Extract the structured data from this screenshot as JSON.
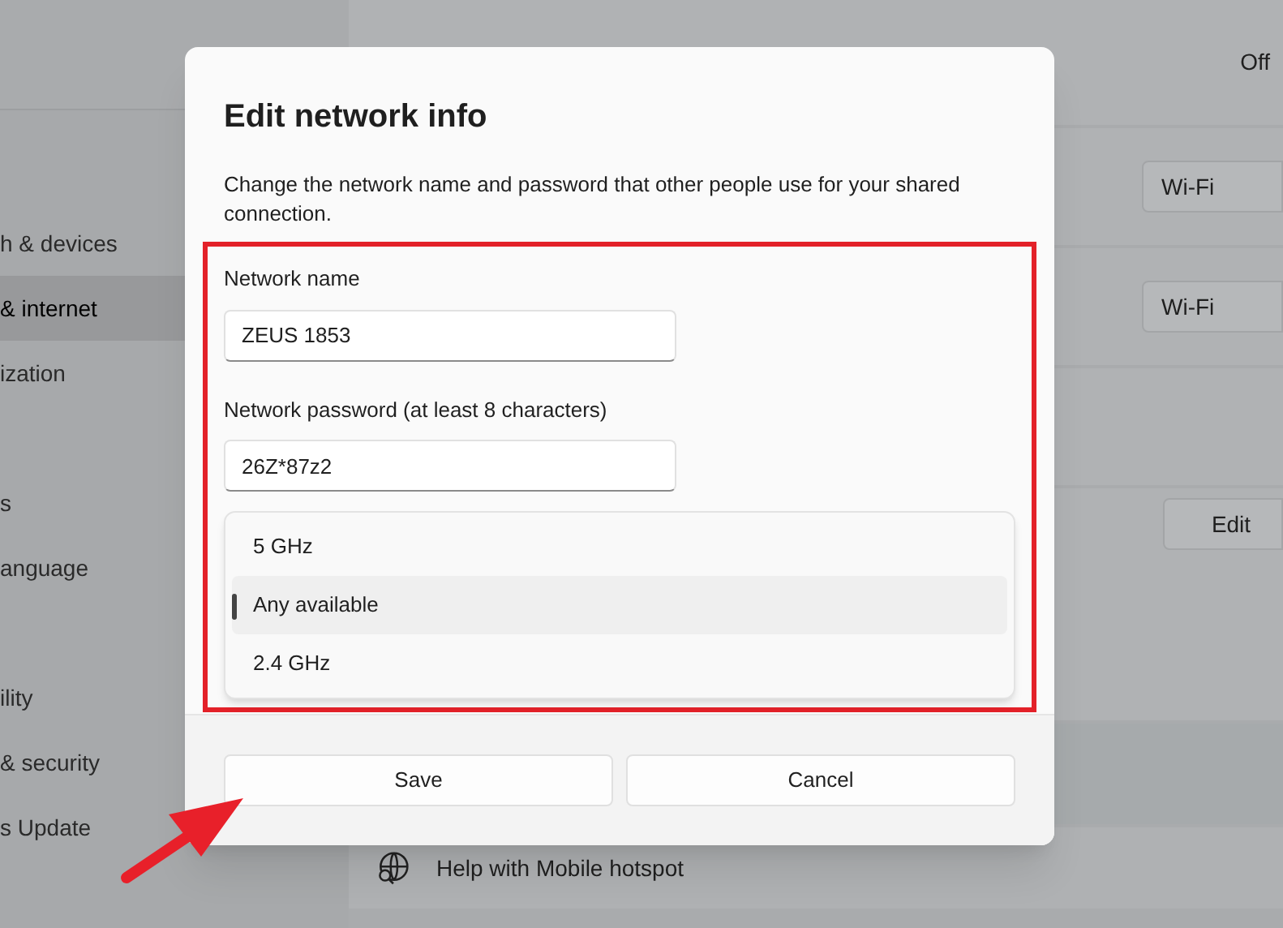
{
  "sidebar": {
    "items": [
      {
        "label": "h & devices",
        "selected": false
      },
      {
        "label": "& internet",
        "selected": true
      },
      {
        "label": "ization",
        "selected": false
      },
      {
        "label": "s",
        "selected": false,
        "gap_before": true
      },
      {
        "label": "anguage",
        "selected": false
      },
      {
        "label": "ility",
        "selected": false,
        "gap_before": true
      },
      {
        "label": "& security",
        "selected": false
      },
      {
        "label": "s Update",
        "selected": false
      }
    ]
  },
  "content": {
    "status": "Off",
    "dropdowns": [
      "Wi-Fi",
      "Wi-Fi"
    ],
    "edit_button": "Edit",
    "help_link": "Help with Mobile hotspot"
  },
  "dialog": {
    "title": "Edit network info",
    "description": "Change the network name and password that other people use for your shared connection.",
    "fields": [
      {
        "label": "Network name",
        "value": "ZEUS 1853"
      },
      {
        "label": "Network password (at least 8 characters)",
        "value": "26Z*87z2"
      }
    ],
    "band_options": [
      {
        "label": "5 GHz",
        "selected": false
      },
      {
        "label": "Any available",
        "selected": true
      },
      {
        "label": "2.4 GHz",
        "selected": false
      }
    ],
    "buttons": [
      "Save",
      "Cancel"
    ]
  }
}
